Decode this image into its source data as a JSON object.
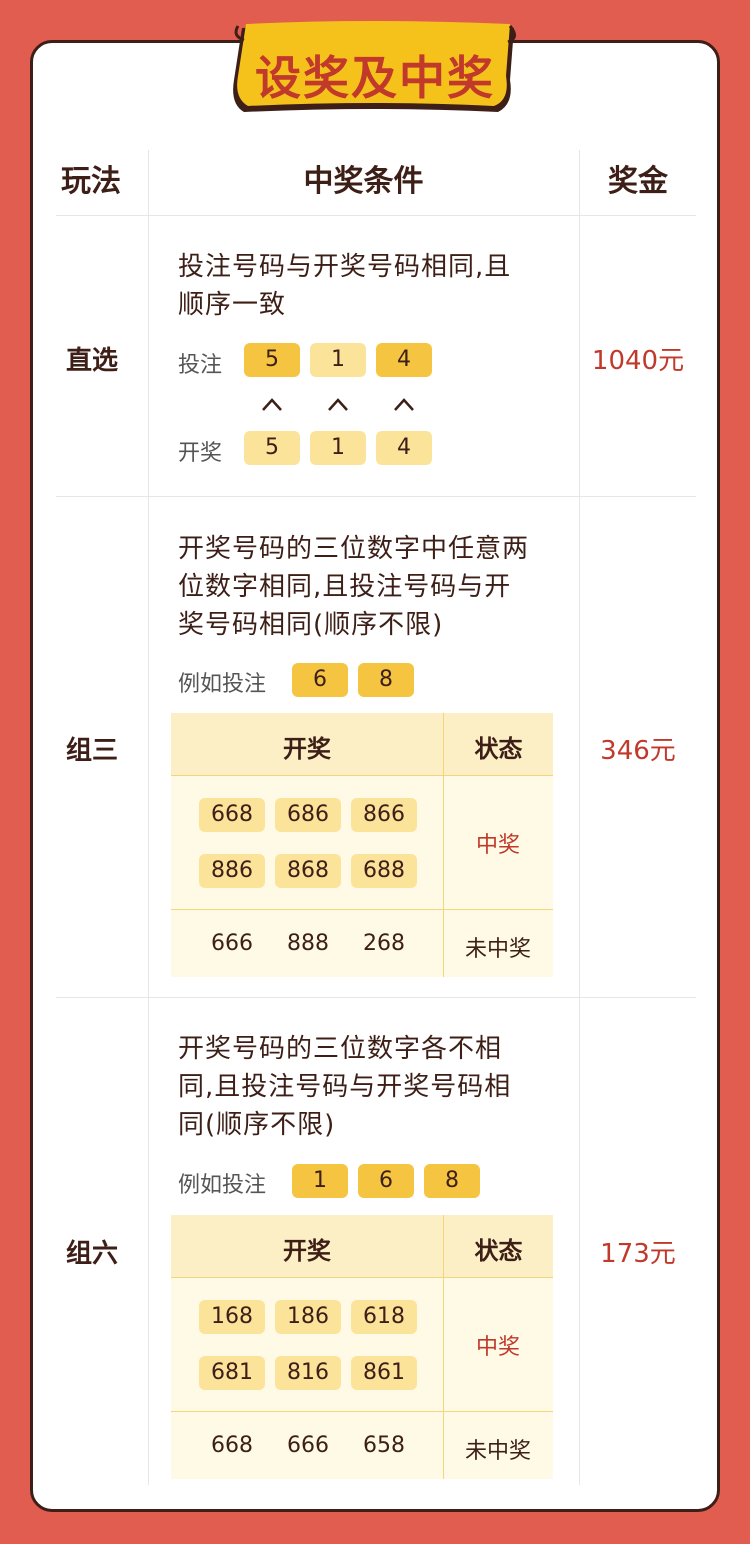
{
  "title": "设奖及中奖",
  "headers": {
    "play": "玩法",
    "condition": "中奖条件",
    "prize": "奖金"
  },
  "zhixuan": {
    "name": "直选",
    "desc": [
      "投注号码与开奖号码相同,且",
      "顺序一致"
    ],
    "bet_label": "投注",
    "bet_numbers": [
      "5",
      "1",
      "4"
    ],
    "draw_label": "开奖",
    "draw_numbers": [
      "5",
      "1",
      "4"
    ],
    "prize": "1040元"
  },
  "zusan": {
    "name": "组三",
    "desc": [
      "开奖号码的三位数字中任意两",
      "位数字相同,且投注号码与开",
      "奖号码相同(顺序不限)"
    ],
    "example_label": "例如投注",
    "example_numbers": [
      "6",
      "8"
    ],
    "table_head": {
      "draw": "开奖",
      "status": "状态"
    },
    "win_numbers": [
      "668",
      "686",
      "866",
      "886",
      "868",
      "688"
    ],
    "win_status": "中奖",
    "lose_numbers": [
      "666",
      "888",
      "268"
    ],
    "lose_status": "未中奖",
    "prize": "346元"
  },
  "zuliu": {
    "name": "组六",
    "desc": [
      "开奖号码的三位数字各不相",
      "同,且投注号码与开奖号码相",
      "同(顺序不限)"
    ],
    "example_label": "例如投注",
    "example_numbers": [
      "1",
      "6",
      "8"
    ],
    "table_head": {
      "draw": "开奖",
      "status": "状态"
    },
    "win_numbers": [
      "168",
      "186",
      "618",
      "681",
      "816",
      "861"
    ],
    "win_status": "中奖",
    "lose_numbers": [
      "668",
      "666",
      "658"
    ],
    "lose_status": "未中奖",
    "prize": "173元"
  },
  "colors": {
    "background": "#e05d4f",
    "accent": "#c0392b",
    "ball": "#f5c542",
    "ball_light": "#fbe39a",
    "banner": "#f5c21b"
  }
}
